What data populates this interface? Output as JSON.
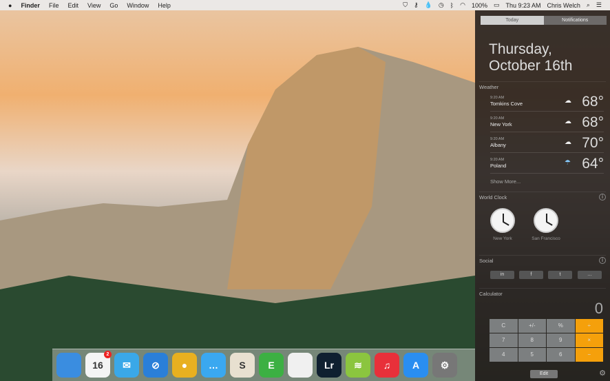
{
  "menubar": {
    "apple": "",
    "items": [
      "Finder",
      "File",
      "Edit",
      "View",
      "Go",
      "Window",
      "Help"
    ],
    "battery": "100%",
    "clock": "Thu 9:23 AM",
    "user": "Chris Welch"
  },
  "nc": {
    "tabs": [
      "Today",
      "Notifications"
    ],
    "date_line1": "Thursday,",
    "date_line2": "October 16th",
    "weather": {
      "title": "Weather",
      "rows": [
        {
          "time": "9:20 AM",
          "city": "Tomkins Cove",
          "temp": "68°",
          "icon": "cloud-icon"
        },
        {
          "time": "9:20 AM",
          "city": "New York",
          "temp": "68°",
          "icon": "cloud-icon"
        },
        {
          "time": "9:20 AM",
          "city": "Albany",
          "temp": "70°",
          "icon": "cloud-icon"
        },
        {
          "time": "9:20 AM",
          "city": "Poland",
          "temp": "64°",
          "icon": "rain-cloud-icon"
        }
      ],
      "show_more": "Show More..."
    },
    "world_clock": {
      "title": "World Clock",
      "clocks": [
        "New York",
        "San Francisco"
      ]
    },
    "social": {
      "title": "Social",
      "buttons": [
        "in",
        "f",
        "t",
        "…"
      ]
    },
    "calculator": {
      "title": "Calculator",
      "display": "0",
      "keys": [
        "C",
        "+/-",
        "%",
        "÷",
        "7",
        "8",
        "9",
        "×",
        "4",
        "5",
        "6",
        "−"
      ],
      "edit": "Edit"
    }
  },
  "dock": {
    "apps": [
      {
        "name": "Finder",
        "color": "#3a8de0",
        "label": ""
      },
      {
        "name": "Calendar",
        "color": "#f4f4f4",
        "label": "16",
        "badge": "2"
      },
      {
        "name": "Mailbox",
        "color": "#3aa8e8",
        "label": "✉"
      },
      {
        "name": "Safari",
        "color": "#2a7fd8",
        "label": "⊘"
      },
      {
        "name": "Chrome",
        "color": "#e8b020",
        "label": "●"
      },
      {
        "name": "Messages",
        "color": "#3aa8f0",
        "label": "…"
      },
      {
        "name": "Slack",
        "color": "#e8e0d0",
        "label": "S"
      },
      {
        "name": "Evernote",
        "color": "#3cb043",
        "label": "E"
      },
      {
        "name": "Notes",
        "color": "#f0f0f0",
        "label": ""
      },
      {
        "name": "Lightroom",
        "color": "#0f2030",
        "label": "Lr"
      },
      {
        "name": "Spotify",
        "color": "#8bc53f",
        "label": "≋"
      },
      {
        "name": "iTunes",
        "color": "#e8303a",
        "label": "♫"
      },
      {
        "name": "App Store",
        "color": "#2a8ef0",
        "label": "A"
      },
      {
        "name": "System Preferences",
        "color": "#777",
        "label": "⚙"
      }
    ]
  }
}
